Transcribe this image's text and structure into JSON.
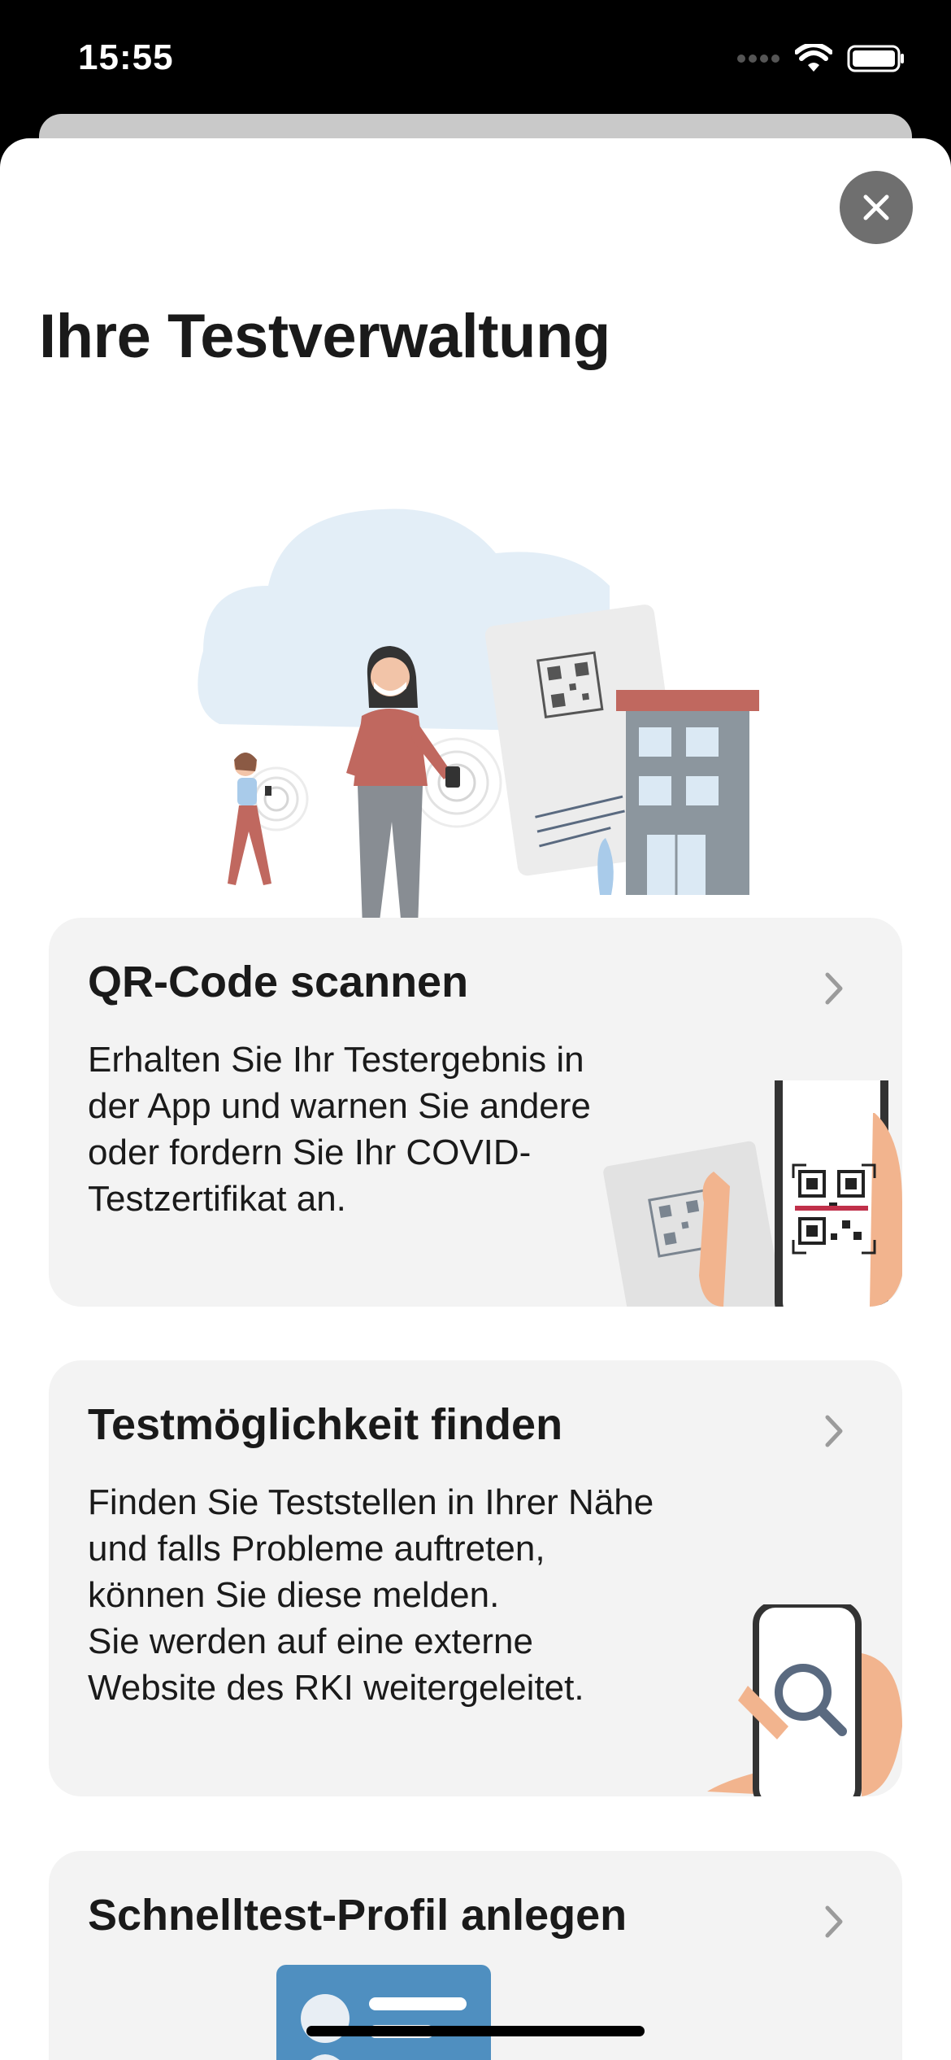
{
  "status_bar": {
    "time": "15:55"
  },
  "sheet": {
    "title": "Ihre Testverwaltung"
  },
  "cards": [
    {
      "title": "QR-Code scannen",
      "body": "Erhalten Sie Ihr Testergebnis in der App und warnen Sie andere oder fordern Sie Ihr COVID-Testzertifikat an."
    },
    {
      "title": "Testmöglichkeit finden",
      "body_line1": "Finden Sie Teststellen in Ihrer Nähe und falls Probleme auftreten, können Sie diese melden.",
      "body_line2": "Sie werden auf eine externe Website des RKI weitergeleitet."
    },
    {
      "title": "Schnelltest-Profil anlegen"
    }
  ],
  "colors": {
    "accent_red": "#c0504d",
    "card_bg": "#f3f3f3",
    "close_bg": "#6f6f6f"
  },
  "icons": [
    "signal-icon",
    "wifi-icon",
    "battery-icon",
    "close-icon",
    "chevron-right-icon"
  ]
}
